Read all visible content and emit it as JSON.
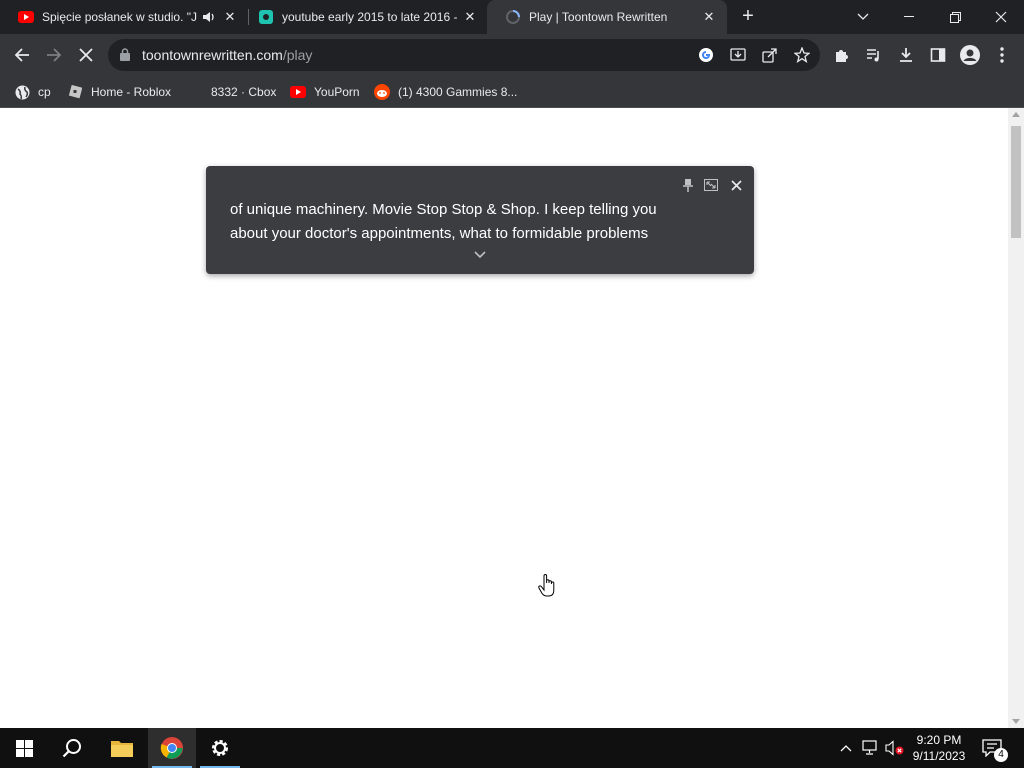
{
  "tabs": [
    {
      "title": "Spięcie posłanek w studio. \"J",
      "favicon": "youtube-icon",
      "muted_icon": "speaker-icon",
      "active": false
    },
    {
      "title": "youtube early 2015 to late 2016 -",
      "favicon": "app-icon",
      "active": false
    },
    {
      "title": "Play | Toontown Rewritten",
      "favicon": "loading-icon",
      "active": true
    }
  ],
  "window_controls": [
    "tab-search-icon",
    "minimize-icon",
    "restore-icon",
    "close-icon"
  ],
  "address_bar": {
    "domain": "toontownrewritten.com",
    "path": "/play"
  },
  "bookmarks": [
    {
      "label": "cp",
      "icon": "globe-icon"
    },
    {
      "label": "Home - Roblox",
      "icon": "roblox-icon"
    },
    {
      "label": "8332 · Cbox",
      "icon": "blank-icon"
    },
    {
      "label": "YouPorn",
      "icon": "youtube-red-icon"
    },
    {
      "label": "(1) 4300 Gammies 8...",
      "icon": "reddit-icon"
    }
  ],
  "caption": {
    "line1": "of unique machinery. Movie Stop Stop & Shop. I keep telling you",
    "line2": "about your doctor's appointments, what to formidable problems"
  },
  "taskbar": {
    "time": "9:20 PM",
    "date": "9/11/2023",
    "notification_count": "4"
  },
  "colors": {
    "tabstrip": "#202124",
    "toolbar": "#35363a",
    "caption_bg": "#3c3d40",
    "taskbar": "#101010"
  }
}
